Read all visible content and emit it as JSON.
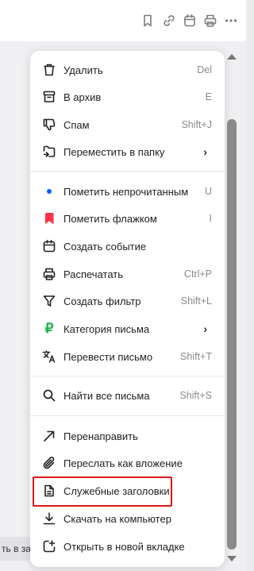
{
  "toolbar": {
    "icons": [
      "bookmark-icon",
      "link-icon",
      "calendar-icon",
      "print-icon",
      "more-icon"
    ]
  },
  "background_peek_text": "ть в за",
  "menu": {
    "items": [
      {
        "label": "Удалить",
        "shortcut": "Del"
      },
      {
        "label": "В архив",
        "shortcut": "E"
      },
      {
        "label": "Спам",
        "shortcut": "Shift+J"
      },
      {
        "label": "Переместить в папку",
        "submenu": "›"
      },
      {
        "label": "Пометить непрочитанным",
        "shortcut": "U"
      },
      {
        "label": "Пометить флажком",
        "shortcut": "I"
      },
      {
        "label": "Создать событие",
        "shortcut": ""
      },
      {
        "label": "Распечатать",
        "shortcut": "Ctrl+P"
      },
      {
        "label": "Создать фильтр",
        "shortcut": "Shift+L"
      },
      {
        "label": "Категория письма",
        "submenu": "›"
      },
      {
        "label": "Перевести письмо",
        "shortcut": "Shift+T"
      },
      {
        "label": "Найти все письма",
        "shortcut": "Shift+S"
      },
      {
        "label": "Перенаправить",
        "shortcut": ""
      },
      {
        "label": "Переслать как вложение",
        "shortcut": ""
      },
      {
        "label": "Служебные заголовки",
        "shortcut": ""
      },
      {
        "label": "Скачать на компьютер",
        "shortcut": ""
      },
      {
        "label": "Открыть в новой вкладке",
        "shortcut": ""
      }
    ]
  },
  "colors": {
    "unread_dot": "#005ff9",
    "flag": "#ff3347",
    "category": "#1ab248",
    "highlight_border": "#e0171a"
  }
}
